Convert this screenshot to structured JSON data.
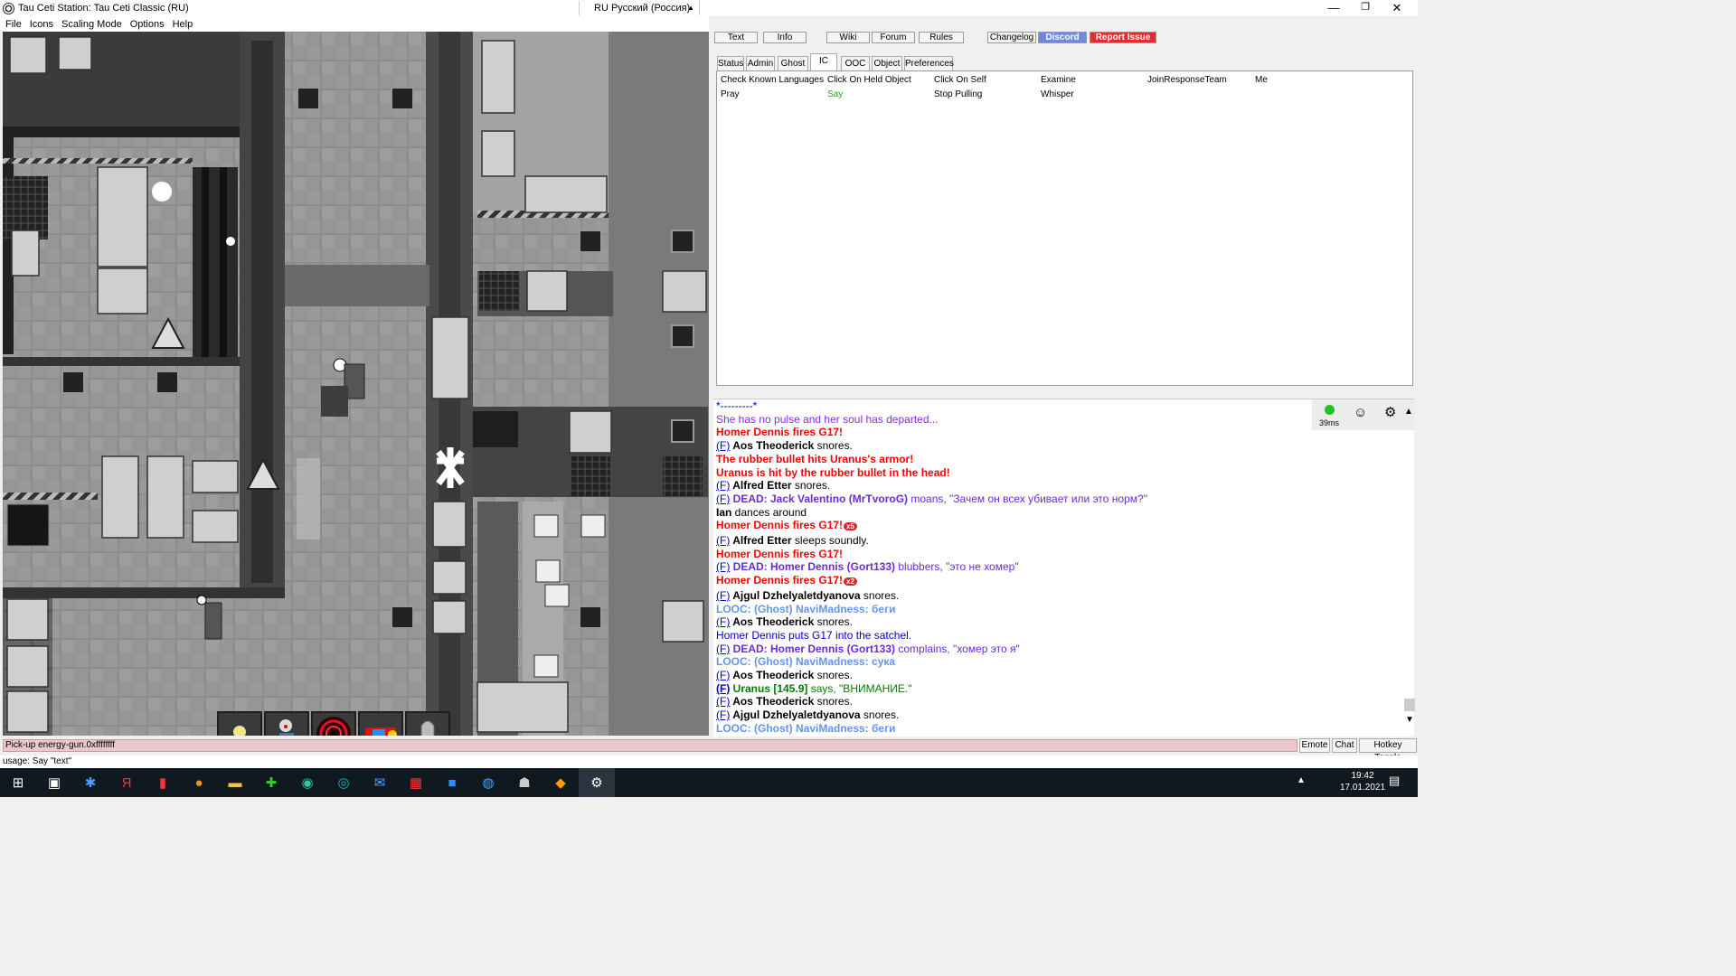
{
  "window": {
    "title": "Tau Ceti Station: Tau Ceti Classic (RU)",
    "language": "RU Русский (Россия)"
  },
  "menu": [
    "File",
    "Icons",
    "Scaling Mode",
    "Options",
    "Help"
  ],
  "top_buttons": [
    "Text",
    "Info",
    "Wiki",
    "Forum",
    "Rules",
    "Changelog",
    "Discord",
    "Report Issue"
  ],
  "tabs": [
    "Status",
    "Admin",
    "Ghost",
    "IC",
    "OOC",
    "Object",
    "Preferences"
  ],
  "verbs": [
    "Check Known Languages",
    "Click On Held Object",
    "Click On Self",
    "Examine",
    "JoinResponseTeam",
    "Me",
    "Pray",
    "Say",
    "Stop Pulling",
    "Whisper"
  ],
  "ping": "39ms",
  "chat": [
    {
      "parts": [
        {
          "t": "*---------*",
          "c": "#0000cc"
        }
      ]
    },
    {
      "parts": [
        {
          "t": "She has no pulse and her soul has departed...",
          "c": "#8a2be2"
        }
      ]
    },
    {
      "parts": [
        {
          "t": "Homer Dennis fires G17!",
          "c": "#ff0000",
          "b": true
        }
      ]
    },
    {
      "parts": [
        {
          "t": "(F)",
          "c": "#0000cc",
          "u": true
        },
        {
          "t": " Aos Theoderick",
          "b": true
        },
        {
          "t": " snores."
        }
      ]
    },
    {
      "parts": [
        {
          "t": "The rubber bullet hits Uranus's armor!",
          "c": "#ff0000",
          "b": true
        }
      ]
    },
    {
      "parts": [
        {
          "t": "Uranus is hit by the rubber bullet in the head!",
          "c": "#ff0000",
          "b": true
        }
      ]
    },
    {
      "parts": [
        {
          "t": "(F)",
          "c": "#0000cc",
          "u": true
        },
        {
          "t": " Alfred Etter",
          "b": true
        },
        {
          "t": " snores."
        }
      ]
    },
    {
      "parts": [
        {
          "t": "(F)",
          "c": "#0000cc",
          "u": true
        },
        {
          "t": " DEAD: Jack Valentino (MrTvoroG)",
          "c": "#6a2bd8",
          "b": true
        },
        {
          "t": " moans, \"Зачем он всех убивает или это норм?\"",
          "c": "#6a2bd8"
        }
      ]
    },
    {
      "parts": [
        {
          "t": "Ian",
          "b": true
        },
        {
          "t": " dances around"
        }
      ]
    },
    {
      "parts": [
        {
          "t": "Homer Dennis fires G17!",
          "c": "#ff0000",
          "b": true
        },
        {
          "t": "x5",
          "badge": true
        }
      ]
    },
    {
      "parts": [
        {
          "t": "(F)",
          "c": "#0000cc",
          "u": true
        },
        {
          "t": " Alfred Etter",
          "b": true
        },
        {
          "t": " sleeps soundly."
        }
      ]
    },
    {
      "parts": [
        {
          "t": "Homer Dennis fires G17!",
          "c": "#ff0000",
          "b": true
        }
      ]
    },
    {
      "parts": [
        {
          "t": "(F)",
          "c": "#0000cc",
          "u": true
        },
        {
          "t": " DEAD: Homer Dennis (Gort133)",
          "c": "#6a2bd8",
          "b": true
        },
        {
          "t": " blubbers, \"это не хомер\"",
          "c": "#6a2bd8"
        }
      ]
    },
    {
      "parts": [
        {
          "t": "Homer Dennis fires G17!",
          "c": "#ff0000",
          "b": true
        },
        {
          "t": "x2",
          "badge": true
        }
      ]
    },
    {
      "parts": [
        {
          "t": "(F)",
          "c": "#0000cc",
          "u": true
        },
        {
          "t": " Ajgul Dzhelyaletdyanova",
          "b": true
        },
        {
          "t": " snores."
        }
      ]
    },
    {
      "parts": [
        {
          "t": "LOOC: (Ghost) NaviMadness: беги",
          "c": "#6495ed",
          "b": true
        }
      ]
    },
    {
      "parts": [
        {
          "t": "(F)",
          "c": "#0000cc",
          "u": true
        },
        {
          "t": " Aos Theoderick",
          "b": true
        },
        {
          "t": " snores."
        }
      ]
    },
    {
      "parts": [
        {
          "t": "Homer Dennis puts G17 into the satchel.",
          "c": "#0000cc"
        }
      ]
    },
    {
      "parts": [
        {
          "t": "(F)",
          "c": "#0000cc",
          "u": true
        },
        {
          "t": " DEAD: Homer Dennis (Gort133)",
          "c": "#6a2bd8",
          "b": true
        },
        {
          "t": " complains, \"хомер это я\"",
          "c": "#6a2bd8"
        }
      ]
    },
    {
      "parts": [
        {
          "t": "LOOC: (Ghost) NaviMadness: сука",
          "c": "#6495ed",
          "b": true
        }
      ]
    },
    {
      "parts": [
        {
          "t": "(F)",
          "c": "#0000cc",
          "u": true
        },
        {
          "t": " Aos Theoderick",
          "b": true
        },
        {
          "t": " snores."
        }
      ]
    },
    {
      "parts": [
        {
          "t": "(F)",
          "c": "#0000cc",
          "u": true,
          "b": true
        },
        {
          "t": " Uranus [145.9]",
          "c": "#008000",
          "b": true
        },
        {
          "t": " says, \"ВНИМАНИЕ.\"",
          "c": "#008000"
        }
      ]
    },
    {
      "parts": [
        {
          "t": "(F)",
          "c": "#0000cc",
          "u": true
        },
        {
          "t": " Aos Theoderick",
          "b": true
        },
        {
          "t": " snores."
        }
      ]
    },
    {
      "parts": [
        {
          "t": "(F)",
          "c": "#0000cc",
          "u": true
        },
        {
          "t": " Ajgul Dzhelyaletdyanova",
          "b": true
        },
        {
          "t": " snores."
        }
      ]
    },
    {
      "parts": [
        {
          "t": "LOOC: (Ghost) NaviMadness: беги",
          "c": "#6495ed",
          "b": true
        }
      ]
    }
  ],
  "status_line": "Pick-up energy-gun.0xffffffff",
  "bottom_buttons": [
    "Emote",
    "Chat",
    "Hotkey Toggle"
  ],
  "command_line": "usage: Say \"text\"",
  "clock": {
    "time": "19:42",
    "date": "17.01.2021"
  },
  "colors": {
    "discord": "#7289da",
    "report": "#e02e2e"
  }
}
